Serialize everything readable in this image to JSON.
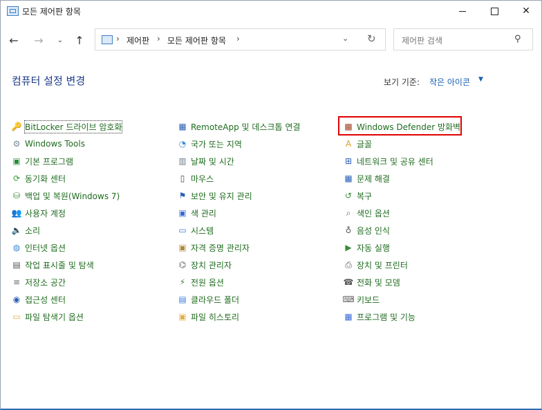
{
  "window": {
    "title": "모든 제어판 항목"
  },
  "nav": {
    "address_crumbs": [
      "제어판",
      "모든 제어판 항목"
    ],
    "search_placeholder": "제어판 검색"
  },
  "header": {
    "title": "컴퓨터 설정 변경",
    "view_by_label": "보기 기준:",
    "view_by_value": "작은 아이콘"
  },
  "columns": [
    [
      {
        "label": "BitLocker 드라이브 암호화",
        "icon": "bitlocker-key-icon",
        "color": "#caa23a"
      },
      {
        "label": "Windows Tools",
        "icon": "windows-tools-icon",
        "color": "#7c8a9a"
      },
      {
        "label": "기본 프로그램",
        "icon": "default-programs-icon",
        "color": "#2a8a3a"
      },
      {
        "label": "동기화 센터",
        "icon": "sync-center-icon",
        "color": "#2e9e2e"
      },
      {
        "label": "백업 및 복원(Windows 7)",
        "icon": "backup-restore-icon",
        "color": "#3a8f3a"
      },
      {
        "label": "사용자 계정",
        "icon": "user-accounts-icon",
        "color": "#5a7ab0"
      },
      {
        "label": "소리",
        "icon": "speaker-icon",
        "color": "#6a6a6a"
      },
      {
        "label": "인터넷 옵션",
        "icon": "internet-options-icon",
        "color": "#3a8ad6"
      },
      {
        "label": "작업 표시줄 및 탐색",
        "icon": "taskbar-icon",
        "color": "#555555"
      },
      {
        "label": "저장소 공간",
        "icon": "storage-spaces-icon",
        "color": "#666666"
      },
      {
        "label": "접근성 센터",
        "icon": "ease-of-access-icon",
        "color": "#2b5fb4"
      },
      {
        "label": "파일 탐색기 옵션",
        "icon": "file-explorer-options-icon",
        "color": "#e0b040"
      }
    ],
    [
      {
        "label": "RemoteApp 및 데스크톱 연결",
        "icon": "remoteapp-icon",
        "color": "#2b5fb4"
      },
      {
        "label": "국가 또는 지역",
        "icon": "region-globe-icon",
        "color": "#3a8ad6"
      },
      {
        "label": "날짜 및 시간",
        "icon": "date-time-icon",
        "color": "#6a7a8a"
      },
      {
        "label": "마우스",
        "icon": "mouse-icon",
        "color": "#444444"
      },
      {
        "label": "보안 및 유지 관리",
        "icon": "security-flag-icon",
        "color": "#2b5fb4"
      },
      {
        "label": "색 관리",
        "icon": "color-management-icon",
        "color": "#3a6ad6"
      },
      {
        "label": "시스템",
        "icon": "system-monitor-icon",
        "color": "#3a7ad6"
      },
      {
        "label": "자격 증명 관리자",
        "icon": "credential-manager-icon",
        "color": "#b08a3a"
      },
      {
        "label": "장치 관리자",
        "icon": "device-manager-icon",
        "color": "#555555"
      },
      {
        "label": "전원 옵션",
        "icon": "power-options-icon",
        "color": "#3a8a3a"
      },
      {
        "label": "클라우드 폴더",
        "icon": "cloud-folder-icon",
        "color": "#3a7ad6"
      },
      {
        "label": "파일 히스토리",
        "icon": "file-history-icon",
        "color": "#e0b040"
      }
    ],
    [
      {
        "label": "Windows Defender 방화벽",
        "icon": "firewall-icon",
        "color": "#a04020"
      },
      {
        "label": "글꼴",
        "icon": "fonts-icon",
        "color": "#d8a020"
      },
      {
        "label": "네트워크 및 공유 센터",
        "icon": "network-sharing-icon",
        "color": "#2b5fb4"
      },
      {
        "label": "문제 해결",
        "icon": "troubleshooting-icon",
        "color": "#2b5fb4"
      },
      {
        "label": "복구",
        "icon": "recovery-icon",
        "color": "#3a8a3a"
      },
      {
        "label": "색인 옵션",
        "icon": "indexing-options-icon",
        "color": "#666666"
      },
      {
        "label": "음성 인식",
        "icon": "speech-recognition-icon",
        "color": "#555555"
      },
      {
        "label": "자동 실행",
        "icon": "autoplay-icon",
        "color": "#3a8a3a"
      },
      {
        "label": "장치 및 프린터",
        "icon": "devices-printers-icon",
        "color": "#555555"
      },
      {
        "label": "전화 및 모뎀",
        "icon": "phone-modem-icon",
        "color": "#555555"
      },
      {
        "label": "키보드",
        "icon": "keyboard-icon",
        "color": "#666666"
      },
      {
        "label": "프로그램 및 기능",
        "icon": "programs-features-icon",
        "color": "#3a6ad6"
      }
    ]
  ]
}
